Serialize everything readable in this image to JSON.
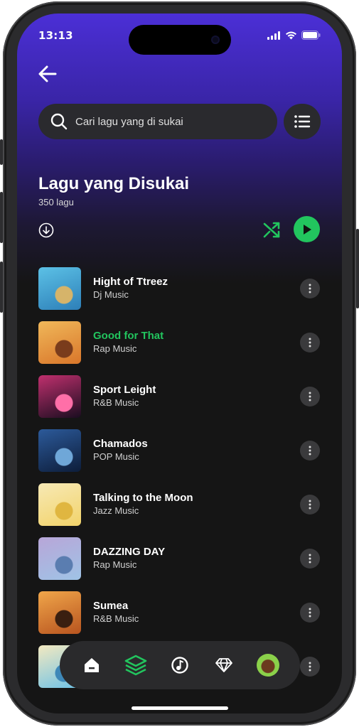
{
  "status": {
    "time": "13:13"
  },
  "search": {
    "placeholder": "Cari lagu yang di sukai"
  },
  "header": {
    "title": "Lagu yang Disukai",
    "count": "350 lagu"
  },
  "songs": [
    {
      "title": "Hight of Ttreez",
      "genre": "Dj Music",
      "active": false,
      "c1": "#2d7fb8",
      "c2": "#5cc1e6",
      "c3": "#d6b46a"
    },
    {
      "title": "Good for That",
      "genre": "Rap Music",
      "active": true,
      "c1": "#d9762a",
      "c2": "#f0b85a",
      "c3": "#7a3c1c"
    },
    {
      "title": "Sport Leight",
      "genre": "R&B Music",
      "active": false,
      "c1": "#1a0d20",
      "c2": "#c0306e",
      "c3": "#ff6fa8"
    },
    {
      "title": "Chamados",
      "genre": "POP Music",
      "active": false,
      "c1": "#0d1d3a",
      "c2": "#2c5a9a",
      "c3": "#6fa7d8"
    },
    {
      "title": "Talking to the Moon",
      "genre": "Jazz Music",
      "active": false,
      "c1": "#f2d36a",
      "c2": "#f7e9b5",
      "c3": "#e0b640"
    },
    {
      "title": "DAZZING DAY",
      "genre": "Rap Music",
      "active": false,
      "c1": "#9fc3e6",
      "c2": "#b8a6d8",
      "c3": "#5a7db0"
    },
    {
      "title": "Sumea",
      "genre": "R&B Music",
      "active": false,
      "c1": "#b8541f",
      "c2": "#f0a64a",
      "c3": "#3a1f10"
    },
    {
      "title": "",
      "genre": "",
      "active": false,
      "c1": "#6fc2e6",
      "c2": "#f3e9c0",
      "c3": "#3e88b8"
    }
  ],
  "nav": [
    "home-icon",
    "library-icon",
    "music-note-icon",
    "diamond-icon",
    "avatar"
  ],
  "colors": {
    "accent": "#22c55e",
    "background": "#151515",
    "gradient_top": "#4b2fd6"
  }
}
